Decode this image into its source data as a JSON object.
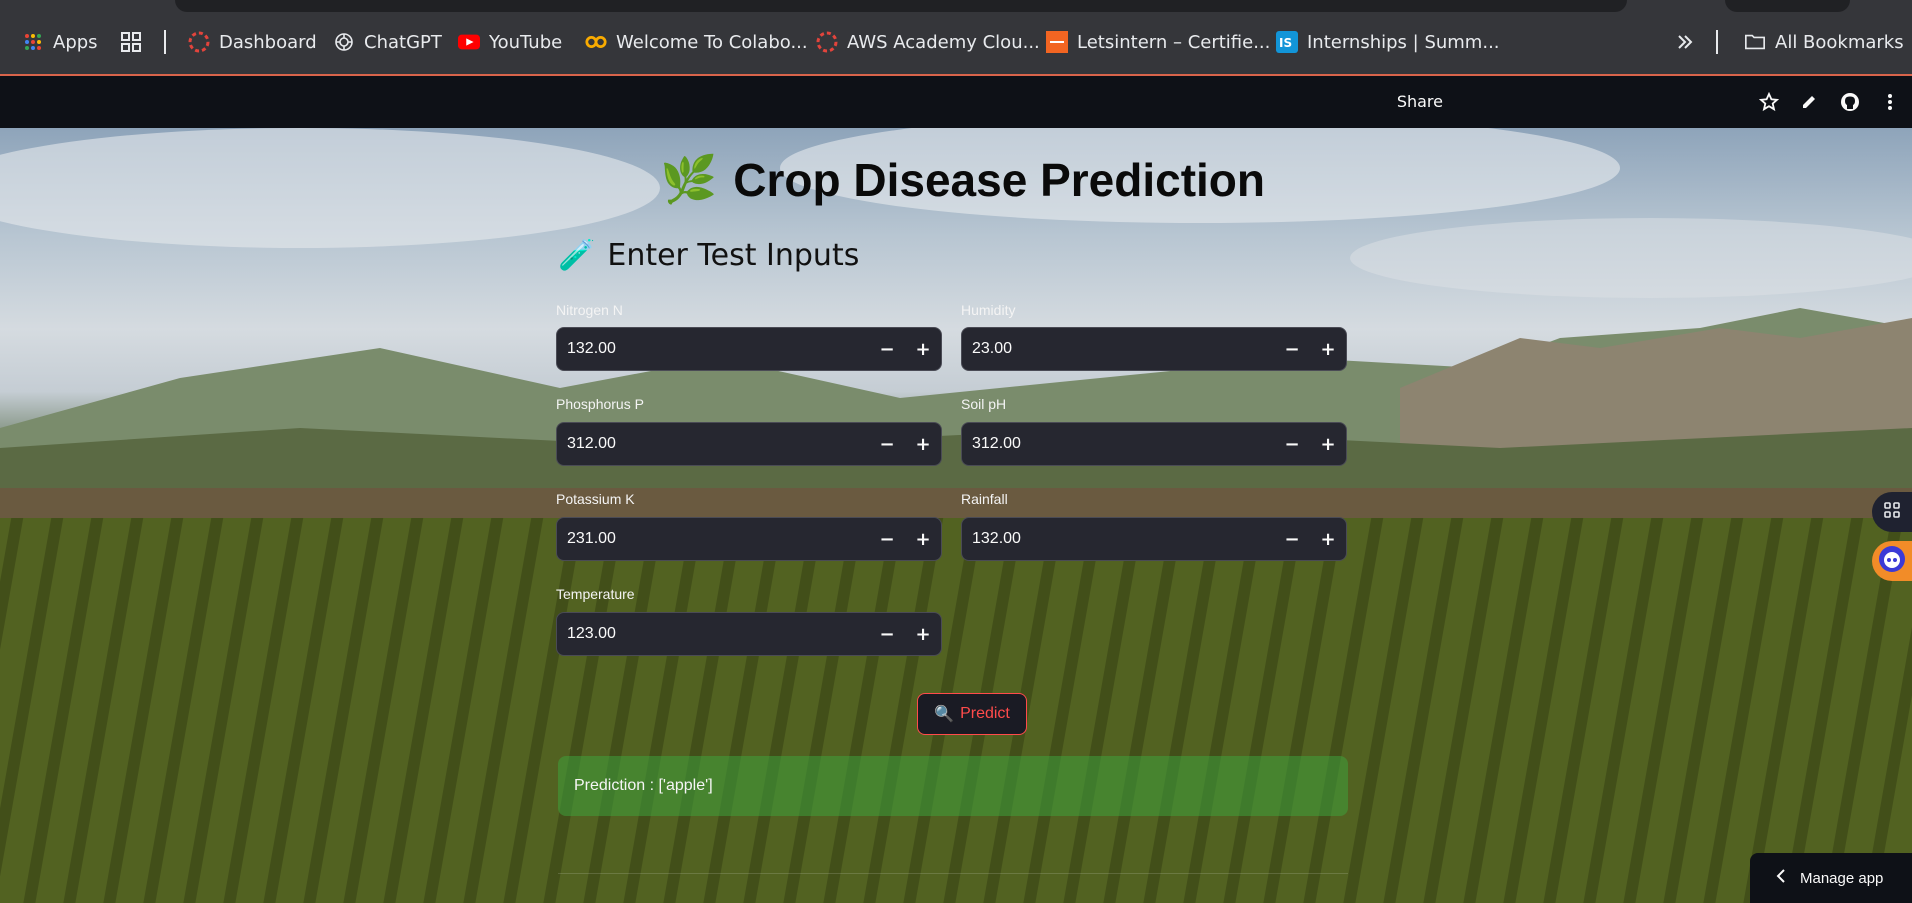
{
  "bookmarks": {
    "items": [
      {
        "label": "Apps",
        "icon": "apps-grid-icon"
      },
      {
        "label": "",
        "icon": "tab-groups-icon"
      },
      {
        "label": "Dashboard",
        "icon": "dashboard-icon"
      },
      {
        "label": "ChatGPT",
        "icon": "chatgpt-icon"
      },
      {
        "label": "YouTube",
        "icon": "youtube-icon"
      },
      {
        "label": "Welcome To Colabo...",
        "icon": "colab-icon"
      },
      {
        "label": "AWS Academy Clou...",
        "icon": "aws-academy-icon"
      },
      {
        "label": "Letsintern – Certifie...",
        "icon": "letsintern-icon"
      },
      {
        "label": "Internships | Summ...",
        "icon": "internshala-icon"
      }
    ],
    "overflow_icon": "chevron-double-right-icon",
    "all_bookmarks": "All Bookmarks"
  },
  "header": {
    "share": "Share"
  },
  "app": {
    "title": "Crop Disease Prediction",
    "title_emoji": "🌿",
    "section_heading": "Enter Test Inputs",
    "section_emoji": "🧪",
    "fields": {
      "nitrogen": {
        "label": "Nitrogen N",
        "value": "132.00"
      },
      "phosphorus": {
        "label": "Phosphorus P",
        "value": "312.00"
      },
      "potassium": {
        "label": "Potassium K",
        "value": "231.00"
      },
      "temperature": {
        "label": "Temperature",
        "value": "123.00"
      },
      "humidity": {
        "label": "Humidity",
        "value": "23.00"
      },
      "soil_ph": {
        "label": "Soil pH",
        "value": "312.00"
      },
      "rainfall": {
        "label": "Rainfall",
        "value": "132.00"
      }
    },
    "stepper_minus": "−",
    "stepper_plus": "+",
    "predict_label": "Predict",
    "predict_emoji": "🔍",
    "prediction_text": "Prediction : ['apple']"
  },
  "footer": {
    "manage_app": "Manage app"
  },
  "colors": {
    "accent": "#ff4b4b",
    "success": "#3ea03c",
    "input_bg": "#262730",
    "header_bg": "#0e1117"
  }
}
